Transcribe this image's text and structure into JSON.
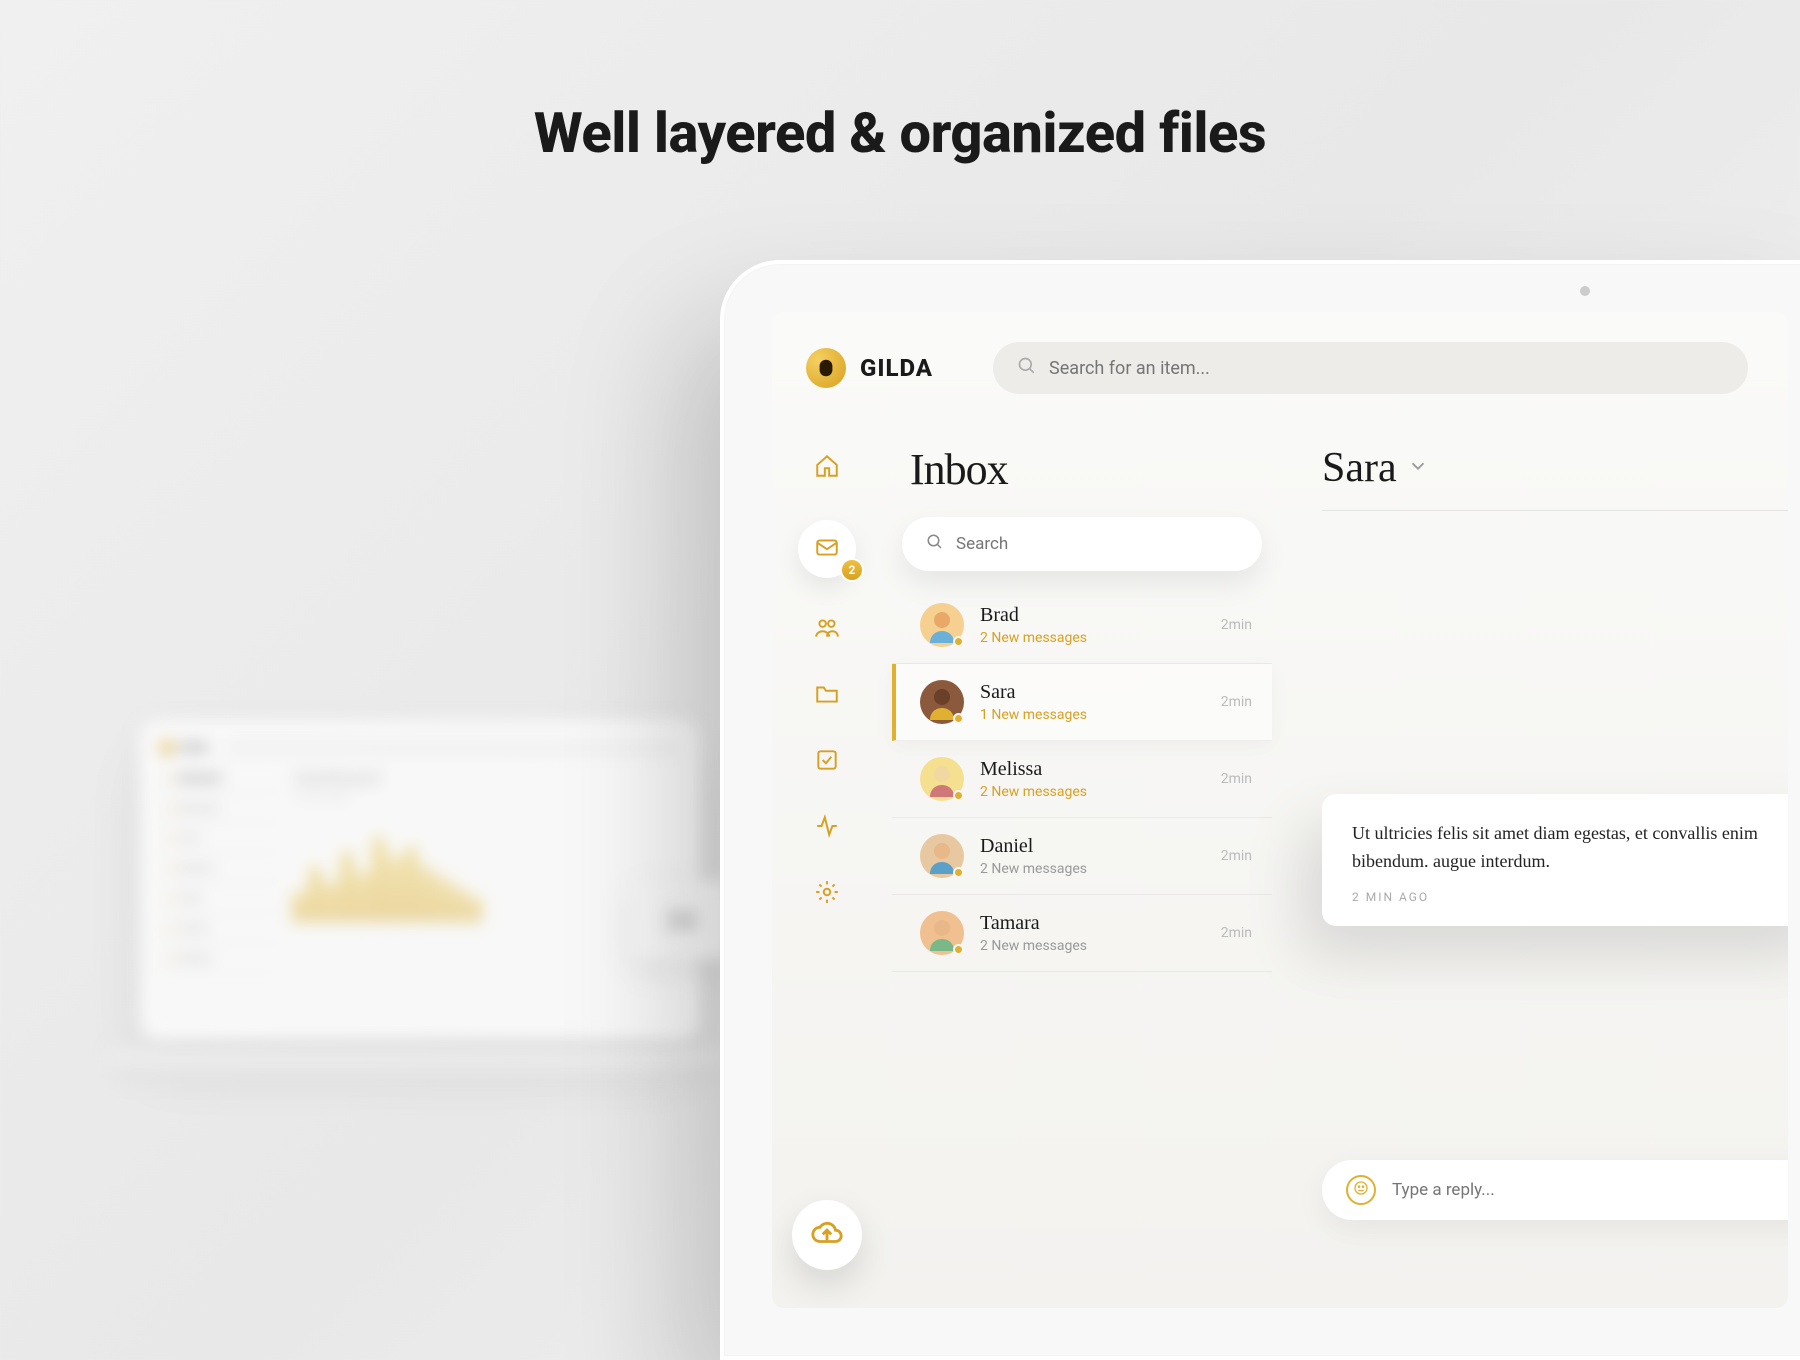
{
  "headline": "Well layered & organized files",
  "brand": {
    "name": "GILDA"
  },
  "topSearch": {
    "placeholder": "Search for an item..."
  },
  "nav": {
    "badge": "2",
    "items": [
      "home",
      "inbox",
      "people",
      "folder",
      "tasks",
      "activity",
      "settings"
    ]
  },
  "inbox": {
    "title": "Inbox",
    "searchPlaceholder": "Search",
    "conversations": [
      {
        "name": "Brad",
        "sub": "2 New messages",
        "time": "2min",
        "highlight": true
      },
      {
        "name": "Sara",
        "sub": "1 New messages",
        "time": "2min",
        "highlight": true,
        "selected": true
      },
      {
        "name": "Melissa",
        "sub": "2 New messages",
        "time": "2min",
        "highlight": true
      },
      {
        "name": "Daniel",
        "sub": "2 New messages",
        "time": "2min",
        "highlight": false
      },
      {
        "name": "Tamara",
        "sub": "2 New messages",
        "time": "2min",
        "highlight": false
      }
    ]
  },
  "chat": {
    "title": "Sara",
    "message": "Ut ultricies felis sit amet diam egestas, et convallis enim bibendum. augue interdum.",
    "messageTime": "2 MIN AGO",
    "replyPlaceholder": "Type a reply..."
  },
  "bgLaptop": {
    "brand": "GILDA",
    "title": "Dashboard",
    "subtitle": "Overall progress",
    "bigNumber": "34",
    "sidebarItems": [
      "Dashboard",
      "Messages",
      "Team",
      "Calendar",
      "Tasks",
      "Activity",
      "Settings"
    ]
  }
}
